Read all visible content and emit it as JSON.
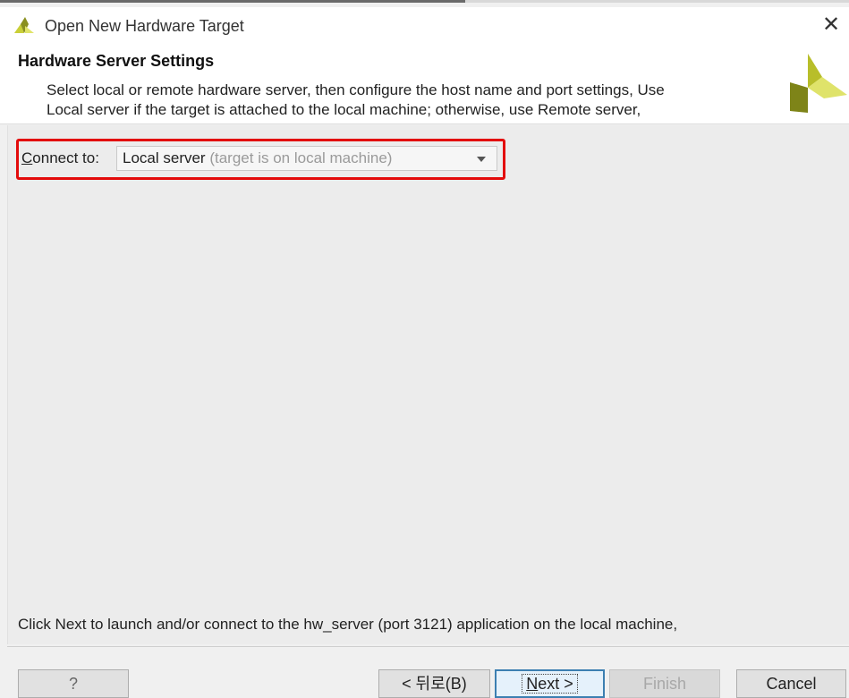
{
  "window": {
    "title": "Open New Hardware Target",
    "close_glyph": "✕"
  },
  "header": {
    "title": "Hardware Server Settings",
    "description_line1": "Select local or remote hardware server, then configure the host name and port settings, Use",
    "description_line2": "Local server if the target is attached to the local machine; otherwise, use Remote server,",
    "logo": "vivado-logo-icon"
  },
  "connect": {
    "label_mnemonic": "C",
    "label_rest": "onnect to:",
    "selected_value": "Local server",
    "selected_hint": "(target is on local machine)",
    "highlight_color": "#e30b0b"
  },
  "footer": {
    "info": "Click Next to launch and/or connect to the hw_server (port 3121) application on the local machine,"
  },
  "buttons": {
    "help": "?",
    "back": "< 뒤로(B)",
    "next_mnemonic": "N",
    "next_rest": "ext >",
    "finish": "Finish",
    "cancel": "Cancel"
  },
  "colors": {
    "accent": "#3c7fb1",
    "logo_yellow": "#c9cf37",
    "logo_olive": "#8a9020"
  }
}
